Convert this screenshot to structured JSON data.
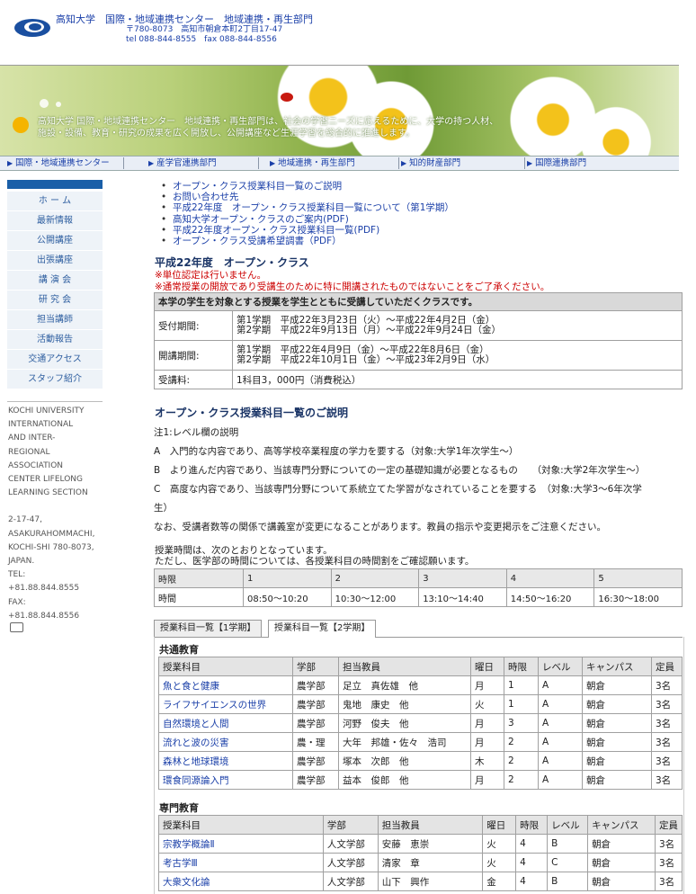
{
  "header": {
    "title": "高知大学　国際・地域連携センター　地域連携・再生部門",
    "address1": "〒780-8073　高知市朝倉本町2丁目17-47",
    "address2": "tel 088-844-8555　fax 088-844-8556"
  },
  "banner": {
    "line1": "高知大学 国際・地域連携センター　地域連携・再生部門は、社会の学習ニーズに応えるために、大学の持つ人材、",
    "line2": "施設・設備、教育・研究の成果を広く開放し、公開講座など生涯学習を総合的に推進します。"
  },
  "nav": [
    "国際・地域連携センター",
    "産学官連携部門",
    "地域連携・再生部門",
    "知的財産部門",
    "国際連携部門"
  ],
  "sidebar": {
    "items": [
      "ホ ー ム",
      "最新情報",
      "公開講座",
      "出張講座",
      "講 演 会",
      "研 究 会",
      "担当講師",
      "活動報告",
      "交通アクセス",
      "スタッフ紹介"
    ],
    "org": [
      "KOCHI UNIVERSITY",
      "INTERNATIONAL",
      "AND INTER-",
      "REGIONAL",
      "ASSOCIATION",
      "CENTER LIFELONG",
      "LEARNING SECTION"
    ],
    "addr": [
      "2-17-47,",
      "ASAKURAHOMMACHI,",
      "KOCHI-SHI 780-8073,",
      "JAPAN.",
      "TEL:",
      "+81.88.844.8555",
      "FAX:",
      "+81.88.844.8556"
    ]
  },
  "links": [
    "オープン・クラス授業科目一覧のご説明",
    "お問い合わせ先",
    "平成22年度　オープン・クラス授業科目一覧について（第1学期）",
    "高知大学オープン・クラスのご案内(PDF)",
    "平成22年度オープン・クラス授業科目一覧(PDF)",
    "オープン・クラス受講希望調書（PDF）"
  ],
  "title1": "平成22年度　オープン・クラス",
  "warn1": "※単位認定は行いません。",
  "warn2": "※通常授業の開放であり受講生のために特に開講されたものではないことをご了承ください。",
  "info": {
    "header": "本学の学生を対象とする授業を学生とともに受講していただくクラスです。",
    "rows": [
      {
        "label": "受付期間:",
        "v1": "第1学期　平成22年3月23日（火）～平成22年4月2日（金）",
        "v2": "第2学期　平成22年9月13日（月）～平成22年9月24日（金）"
      },
      {
        "label": "開講期間:",
        "v1": "第1学期　平成22年4月9日（金）～平成22年8月6日（金）",
        "v2": "第2学期　平成22年10月1日（金）～平成23年2月9日（水）"
      },
      {
        "label": "受講料:",
        "v1": "1科目3，000円（消費税込）",
        "v2": ""
      }
    ]
  },
  "title2": "オープン・クラス授業科目一覧のご説明",
  "notes": [
    "注1:レベル欄の説明",
    "A　入門的な内容であり、高等学校卒業程度の学力を要する（対象:大学1年次学生～）",
    "B　より進んだ内容であり、当該専門分野についての一定の基礎知識が必要となるもの　　（対象:大学2年次学生～）",
    "C　高度な内容であり、当該専門分野について系統立てた学習がなされていることを要する　（対象:大学3～6年次学",
    "生）",
    "なお、受講者数等の関係で講義室が変更になることがあります。教員の指示や変更掲示をご注意ください。"
  ],
  "sched_intro1": "授業時間は、次のとおりとなっています。",
  "sched_intro2": "ただし、医学部の時間については、各授業科目の時間割をご確認願います。",
  "schedule": {
    "h": [
      "時限",
      "1",
      "2",
      "3",
      "4",
      "5"
    ],
    "r": [
      "時間",
      "08:50～10:20",
      "10:30～12:00",
      "13:10～14:40",
      "14:50～16:20",
      "16:30～18:00"
    ]
  },
  "tabs": [
    "授業科目一覧【1学期】",
    "授業科目一覧【2学期】"
  ],
  "common": {
    "title": "共通教育",
    "headers": [
      "授業科目",
      "学部",
      "担当教員",
      "曜日",
      "時限",
      "レベル",
      "キャンパス",
      "定員"
    ],
    "rows": [
      [
        "魚と食と健康",
        "農学部",
        "足立　真佐雄　他",
        "月",
        "1",
        "A",
        "朝倉",
        "3名"
      ],
      [
        "ライフサイエンスの世界",
        "農学部",
        "鬼地　康史　他",
        "火",
        "1",
        "A",
        "朝倉",
        "3名"
      ],
      [
        "自然環境と人間",
        "農学部",
        "河野　俊夫　他",
        "月",
        "3",
        "A",
        "朝倉",
        "3名"
      ],
      [
        "流れと波の災害",
        "農・理",
        "大年　邦雄・佐々　浩司",
        "月",
        "2",
        "A",
        "朝倉",
        "3名"
      ],
      [
        "森林と地球環境",
        "農学部",
        "塚本　次郎　他",
        "木",
        "2",
        "A",
        "朝倉",
        "3名"
      ],
      [
        "環食同源論入門",
        "農学部",
        "益本　俊郎　他",
        "月",
        "2",
        "A",
        "朝倉",
        "3名"
      ]
    ]
  },
  "special": {
    "title": "専門教育",
    "headers": [
      "授業科目",
      "学部",
      "担当教員",
      "曜日",
      "時限",
      "レベル",
      "キャンパス",
      "定員"
    ],
    "rows": [
      [
        "宗教学概論Ⅱ",
        "人文学部",
        "安藤　恵崇",
        "火",
        "4",
        "B",
        "朝倉",
        "3名"
      ],
      [
        "考古学Ⅲ",
        "人文学部",
        "清家　章",
        "火",
        "4",
        "C",
        "朝倉",
        "3名"
      ],
      [
        "大衆文化論",
        "人文学部",
        "山下　興作",
        "金",
        "4",
        "B",
        "朝倉",
        "3名"
      ]
    ]
  }
}
